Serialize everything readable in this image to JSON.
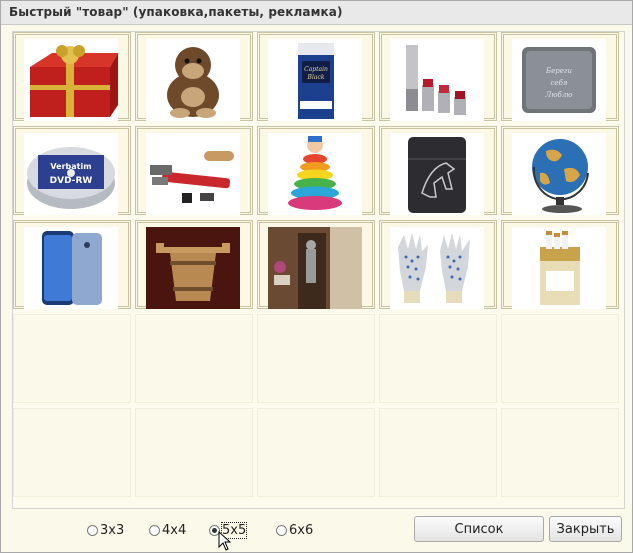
{
  "window": {
    "title": "Быстрый \"товар\" (упаковка,пакеты, рекламка)"
  },
  "grid": {
    "items": [
      {
        "name": "gift-box-image",
        "icon": "gift-box"
      },
      {
        "name": "plush-monkey-image",
        "icon": "plush-monkey"
      },
      {
        "name": "cigarette-pack-image",
        "icon": "cigarette-pack",
        "text": "Captain Black"
      },
      {
        "name": "lipsticks-image",
        "icon": "lipsticks"
      },
      {
        "name": "engraved-lighter-image",
        "icon": "engraved-lighter",
        "text": "Береги себя Люблю"
      },
      {
        "name": "dvd-spindle-image",
        "icon": "dvd-spindle",
        "text": "Verbatim DVD-RW"
      },
      {
        "name": "pipe-wrench-image",
        "icon": "pipe-wrench"
      },
      {
        "name": "stacking-toy-image",
        "icon": "stacking-toy"
      },
      {
        "name": "horse-lighter-image",
        "icon": "horse-lighter"
      },
      {
        "name": "globe-image",
        "icon": "globe"
      },
      {
        "name": "smartphone-image",
        "icon": "smartphone"
      },
      {
        "name": "wooden-bucket-image",
        "icon": "wooden-bucket"
      },
      {
        "name": "room-interior-image",
        "icon": "room-interior"
      },
      {
        "name": "dotted-gloves-image",
        "icon": "dotted-gloves"
      },
      {
        "name": "cigarettes-pack-image",
        "icon": "cigarettes-pack"
      }
    ]
  },
  "footer": {
    "radios": [
      {
        "label": "3x3",
        "checked": false
      },
      {
        "label": "4x4",
        "checked": false
      },
      {
        "label": "5x5",
        "checked": true
      },
      {
        "label": "6x6",
        "checked": false
      }
    ],
    "list_button": "Список",
    "close_button": "Закрыть"
  },
  "colors": {
    "panel_bg": "#fbf9e9",
    "cell_border": "#c8c3a0",
    "titlebar_bg": "#e9e9e9"
  }
}
